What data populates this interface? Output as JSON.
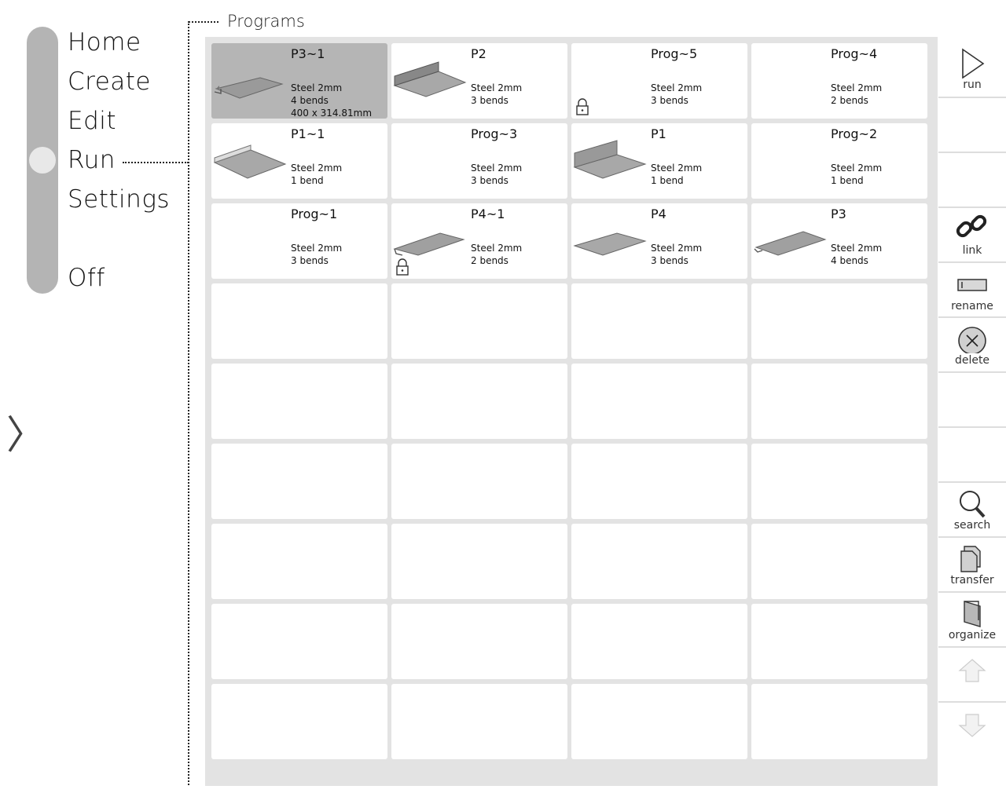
{
  "nav": {
    "items": [
      {
        "label": "Home"
      },
      {
        "label": "Create"
      },
      {
        "label": "Edit"
      },
      {
        "label": "Run",
        "active": true
      },
      {
        "label": "Settings"
      },
      {
        "label": "Off"
      }
    ],
    "expand_icon": "chevron-right-icon",
    "expand_glyph": "〉"
  },
  "panel": {
    "title": "Programs"
  },
  "programs": [
    {
      "name": "P3~1",
      "material": "Steel 2mm",
      "bends": "4 bends",
      "dims": "400 x 314.81mm",
      "selected": true,
      "locked": false
    },
    {
      "name": "P2",
      "material": "Steel 2mm",
      "bends": "3 bends",
      "locked": false
    },
    {
      "name": "Prog~5",
      "material": "Steel 2mm",
      "bends": "3 bends",
      "locked": true
    },
    {
      "name": "Prog~4",
      "material": "Steel 2mm",
      "bends": "2 bends",
      "locked": false
    },
    {
      "name": "P1~1",
      "material": "Steel 2mm",
      "bends": "1 bend",
      "locked": false
    },
    {
      "name": "Prog~3",
      "material": "Steel 2mm",
      "bends": "3 bends",
      "locked": false
    },
    {
      "name": "P1",
      "material": "Steel 2mm",
      "bends": "1 bend",
      "locked": false
    },
    {
      "name": "Prog~2",
      "material": "Steel 2mm",
      "bends": "1 bend",
      "locked": false
    },
    {
      "name": "Prog~1",
      "material": "Steel 2mm",
      "bends": "3 bends",
      "locked": false
    },
    {
      "name": "P4~1",
      "material": "Steel 2mm",
      "bends": "2 bends",
      "locked": true
    },
    {
      "name": "P4",
      "material": "Steel 2mm",
      "bends": "3 bends",
      "locked": false
    },
    {
      "name": "P3",
      "material": "Steel 2mm",
      "bends": "4 bends",
      "locked": false
    }
  ],
  "toolbar": {
    "run_label": "run",
    "link_label": "link",
    "rename_label": "rename",
    "delete_label": "delete",
    "search_label": "search",
    "transfer_label": "transfer",
    "organize_label": "organize"
  },
  "colors": {
    "selected_tile": "#b5b5b5",
    "panel_bg": "#e3e3e3",
    "nav_track": "#b4b4b4"
  }
}
